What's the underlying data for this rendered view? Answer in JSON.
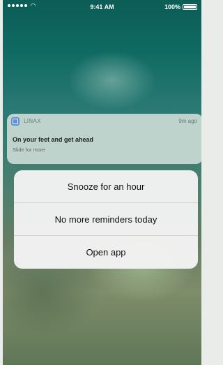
{
  "status_bar": {
    "time": "9:41 AM",
    "battery": "100%"
  },
  "notification": {
    "app_name": "LINAX",
    "time_ago": "9m ago",
    "title": "On your feet and get ahead",
    "subtitle": "Slide for more"
  },
  "actions": [
    {
      "label": "Snooze for an hour"
    },
    {
      "label": "No more reminders today"
    },
    {
      "label": "Open app"
    }
  ],
  "icons": [
    "signal-icon",
    "wifi-icon",
    "battery-icon",
    "app-icon"
  ]
}
